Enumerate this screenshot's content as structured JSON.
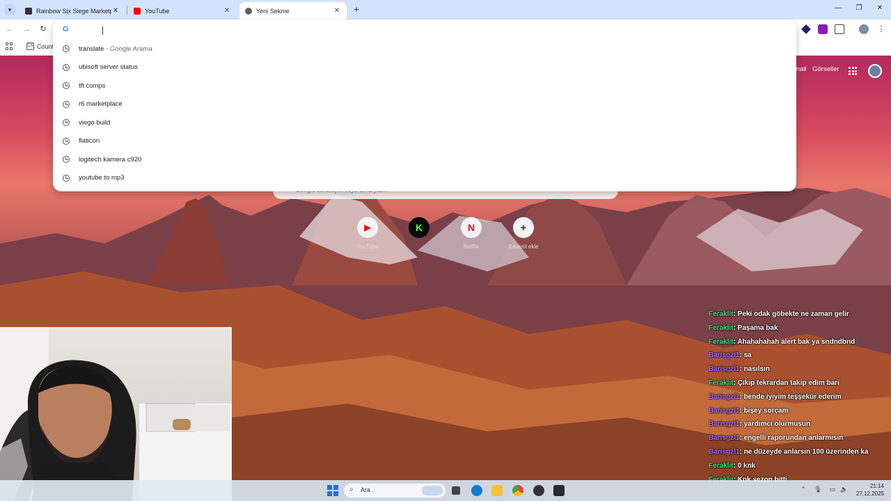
{
  "browser": {
    "tabs": [
      {
        "title": "Rainbow Six Siege Marketplace",
        "active": false
      },
      {
        "title": "YouTube",
        "active": false
      },
      {
        "title": "Yeni Sekme",
        "active": true
      }
    ],
    "bookmark_label": "Count",
    "bookmark_icon_text": "CS"
  },
  "omnibox": {
    "logo": "G",
    "suggestions": [
      {
        "text": "translate",
        "sub": " - Google Arama"
      },
      {
        "text": "ubisoft server status",
        "sub": ""
      },
      {
        "text": "tft comps",
        "sub": ""
      },
      {
        "text": "r6 marketplace",
        "sub": ""
      },
      {
        "text": "viego build",
        "sub": ""
      },
      {
        "text": "flaticon",
        "sub": ""
      },
      {
        "text": "logitech kamera c920",
        "sub": ""
      },
      {
        "text": "youtube to mp3",
        "sub": ""
      }
    ]
  },
  "newtab": {
    "header_gmail": "mail",
    "header_images": "Görseller",
    "search_placeholder": "Google'da arayın veya URL yazın",
    "shortcuts": [
      {
        "label": "YouTube",
        "glyph": "▶",
        "color": "#ff0000"
      },
      {
        "label": "",
        "glyph": "K",
        "color": "#53fc18"
      },
      {
        "label": "Netflix",
        "glyph": "N",
        "color": "#e50914"
      },
      {
        "label": "Kısayol ekle",
        "glyph": "+",
        "color": "#202124"
      }
    ]
  },
  "chat": [
    {
      "user": "Feraklit",
      "msg": ": Peki odak göbekte ne zaman gelir",
      "color": "green"
    },
    {
      "user": "Feraklit",
      "msg": ": Paşama bak",
      "color": "green"
    },
    {
      "user": "Feraklit",
      "msg": ": Ahahahahah alert bak ya sndndbnd",
      "color": "green"
    },
    {
      "user": "Barisgzl1",
      "msg": ": sa",
      "color": "purple"
    },
    {
      "user": "Barisgzl1",
      "msg": ": nasılsın",
      "color": "purple"
    },
    {
      "user": "Feraklit",
      "msg": ": Çıkıp tekrardan takip edim bari",
      "color": "green"
    },
    {
      "user": "Barisgzl1",
      "msg": ": bende iyiyim teşşekür ederim",
      "color": "purple"
    },
    {
      "user": "Barisgzl1",
      "msg": ": bişey sorçam",
      "color": "purple"
    },
    {
      "user": "Barisgzl1",
      "msg": ": yardımcı olurmusun",
      "color": "purple"
    },
    {
      "user": "Barisgzl1",
      "msg": ": engelli raporundan anlarmısın",
      "color": "purple"
    },
    {
      "user": "Barisgzl1",
      "msg": ": ne düzeyde anlarsın 100 üzerinden ka",
      "color": "purple"
    },
    {
      "user": "Feraklit",
      "msg": ": 0 knk",
      "color": "green"
    },
    {
      "user": "Feraklit",
      "msg": ": Knk sezon bitti",
      "color": "green"
    }
  ],
  "taskbar": {
    "search_label": "Ara",
    "time": "21:14",
    "date": "27.12.2025"
  },
  "colors": {
    "tabstrip": "#d3e3fd",
    "chat_green": "#3ee07a",
    "chat_purple": "#a86cff"
  }
}
